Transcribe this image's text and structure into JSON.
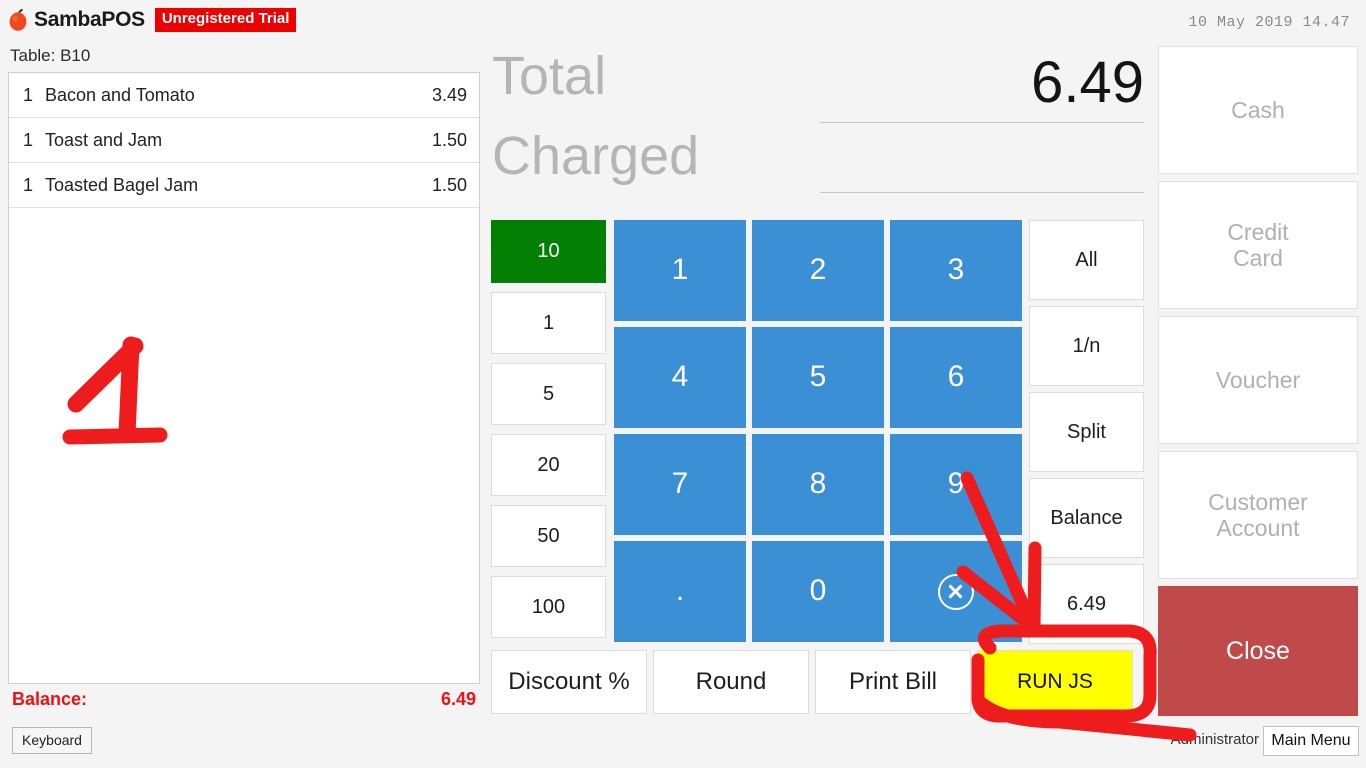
{
  "header": {
    "brand": "SambaPOS",
    "trial_badge": "Unregistered Trial",
    "table_label": "Table: B10",
    "datetime": "10 May 2019 14.47",
    "logo_icon": "apple-logo-icon"
  },
  "order_panel": {
    "rows": [
      {
        "qty": "1",
        "name": "Bacon and Tomato",
        "price": "3.49"
      },
      {
        "qty": "1",
        "name": "Toast and Jam",
        "price": "1.50"
      },
      {
        "qty": "1",
        "name": "Toasted Bagel Jam",
        "price": "1.50"
      }
    ],
    "balance_label": "Balance:",
    "balance_value": "6.49",
    "keyboard_button": "Keyboard"
  },
  "totals": {
    "total_label": "Total",
    "total_value": "6.49",
    "charged_label": "Charged",
    "charged_value": ""
  },
  "quick_amounts": [
    {
      "label": "10",
      "style": "green"
    },
    {
      "label": "1",
      "style": "white"
    },
    {
      "label": "5",
      "style": "white"
    },
    {
      "label": "20",
      "style": "white"
    },
    {
      "label": "50",
      "style": "white"
    },
    {
      "label": "100",
      "style": "white"
    }
  ],
  "keypad": {
    "rows": [
      [
        "1",
        "2",
        "3"
      ],
      [
        "4",
        "5",
        "6"
      ],
      [
        "7",
        "8",
        "9"
      ],
      [
        ".",
        "0",
        "clear-icon"
      ]
    ],
    "clear_icon_name": "clear-circle-x-icon"
  },
  "actions": [
    {
      "label": "All"
    },
    {
      "label": "1/n"
    },
    {
      "label": "Split"
    },
    {
      "label": "Balance"
    },
    {
      "label": "6.49"
    }
  ],
  "bottom_buttons": [
    {
      "label": "Discount %",
      "style": "white"
    },
    {
      "label": "Round",
      "style": "white"
    },
    {
      "label": "Print Bill",
      "style": "white"
    },
    {
      "label": "RUN JS",
      "style": "yellow"
    }
  ],
  "payment_buttons": [
    {
      "label": "Cash",
      "style": "disabled"
    },
    {
      "label": "Credit\nCard",
      "line1": "Credit",
      "line2": "Card",
      "style": "disabled"
    },
    {
      "label": "Voucher",
      "style": "disabled"
    },
    {
      "label": "Customer\nAccount",
      "line1": "Customer",
      "line2": "Account",
      "style": "disabled"
    },
    {
      "label": "Close",
      "style": "red"
    }
  ],
  "status_bar": {
    "user": "Administrator",
    "main_menu_button": "Main Menu"
  },
  "annotations": {
    "color": "#ee1c1c",
    "marks": [
      {
        "name": "handdrawn-number-one",
        "text": "1"
      },
      {
        "name": "arrow-to-run-js"
      },
      {
        "name": "circle-around-run-js"
      }
    ]
  }
}
